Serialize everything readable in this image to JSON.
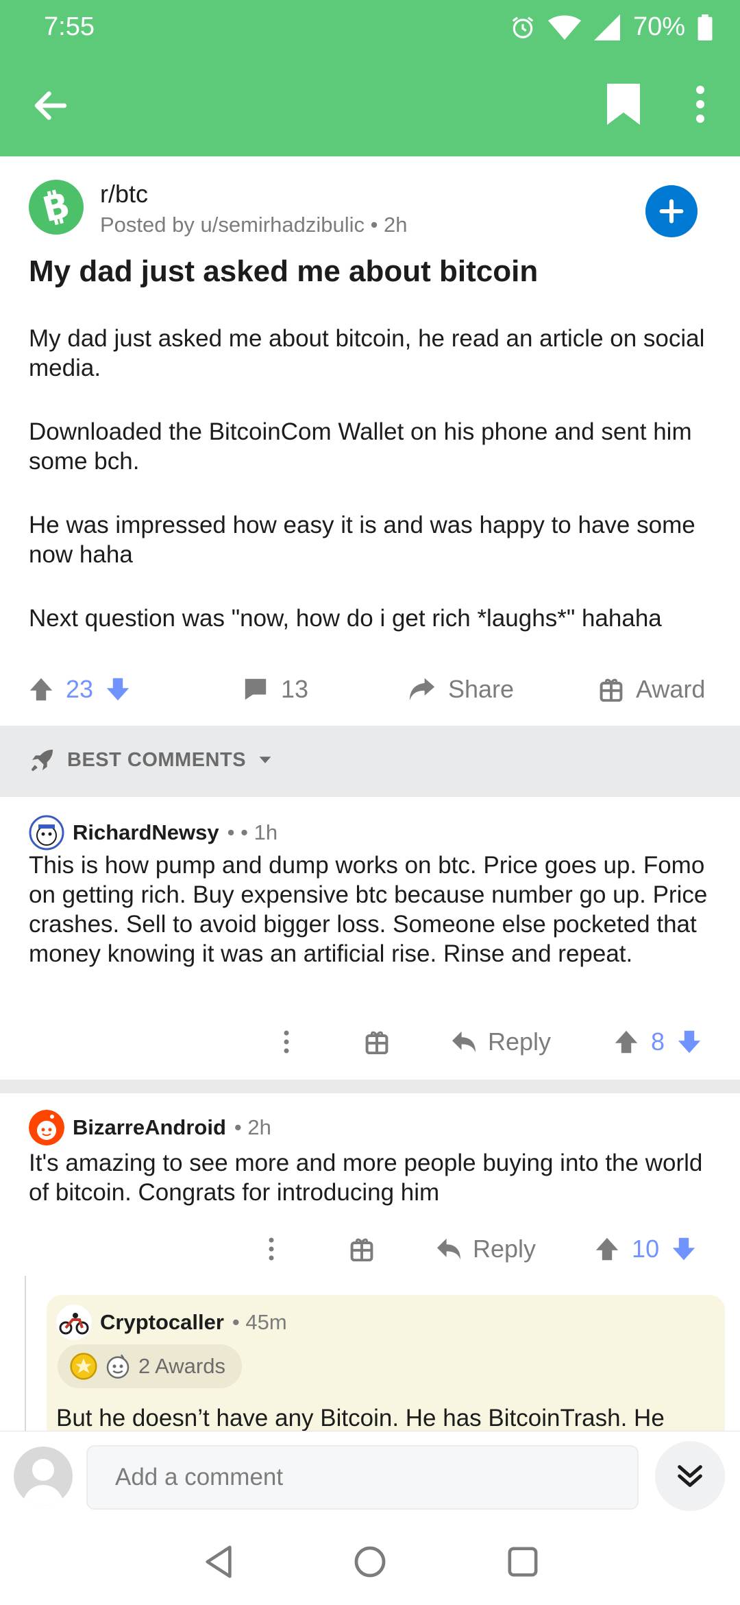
{
  "status_bar": {
    "time": "7:55",
    "battery": "70%"
  },
  "post": {
    "subreddit": "r/btc",
    "posted_by": "Posted by u/semirhadzibulic • 2h",
    "title": "My dad just asked me about bitcoin",
    "body": [
      "My dad just asked me about bitcoin, he read an article on social media.",
      "Downloaded the BitcoinCom Wallet on his phone and sent him some bch.",
      "He was impressed how easy it is and was happy to have some now haha",
      "Next question was \"now, how do i get rich *laughs*\" hahaha"
    ],
    "votes": "23",
    "comments": "13",
    "share_label": "Share",
    "award_label": "Award"
  },
  "sort": {
    "label": "BEST COMMENTS"
  },
  "comments": [
    {
      "user": "RichardNewsy",
      "meta": "•  • 1h",
      "body": "This is how pump and dump works on btc. Price goes up. Fomo on getting rich. Buy expensive btc because number go up. Price crashes. Sell to avoid bigger loss. Someone else pocketed that money knowing it was an artificial rise. Rinse and repeat.",
      "reply_label": "Reply",
      "votes": "8"
    },
    {
      "user": "BizarreAndroid",
      "meta": "• 2h",
      "body": "It's amazing to see more and more people buying into the world of bitcoin. Congrats for introducing him",
      "reply_label": "Reply",
      "votes": "10"
    },
    {
      "user": "Cryptocaller",
      "meta": "• 45m",
      "awards": "2 Awards",
      "body": "But he doesn’t have any Bitcoin. He has BitcoinTrash. He"
    }
  ],
  "composer": {
    "placeholder": "Add a comment"
  },
  "colors": {
    "header": "#5dca7a",
    "upvote_number": "#7193ff",
    "join": "#0079d3"
  }
}
